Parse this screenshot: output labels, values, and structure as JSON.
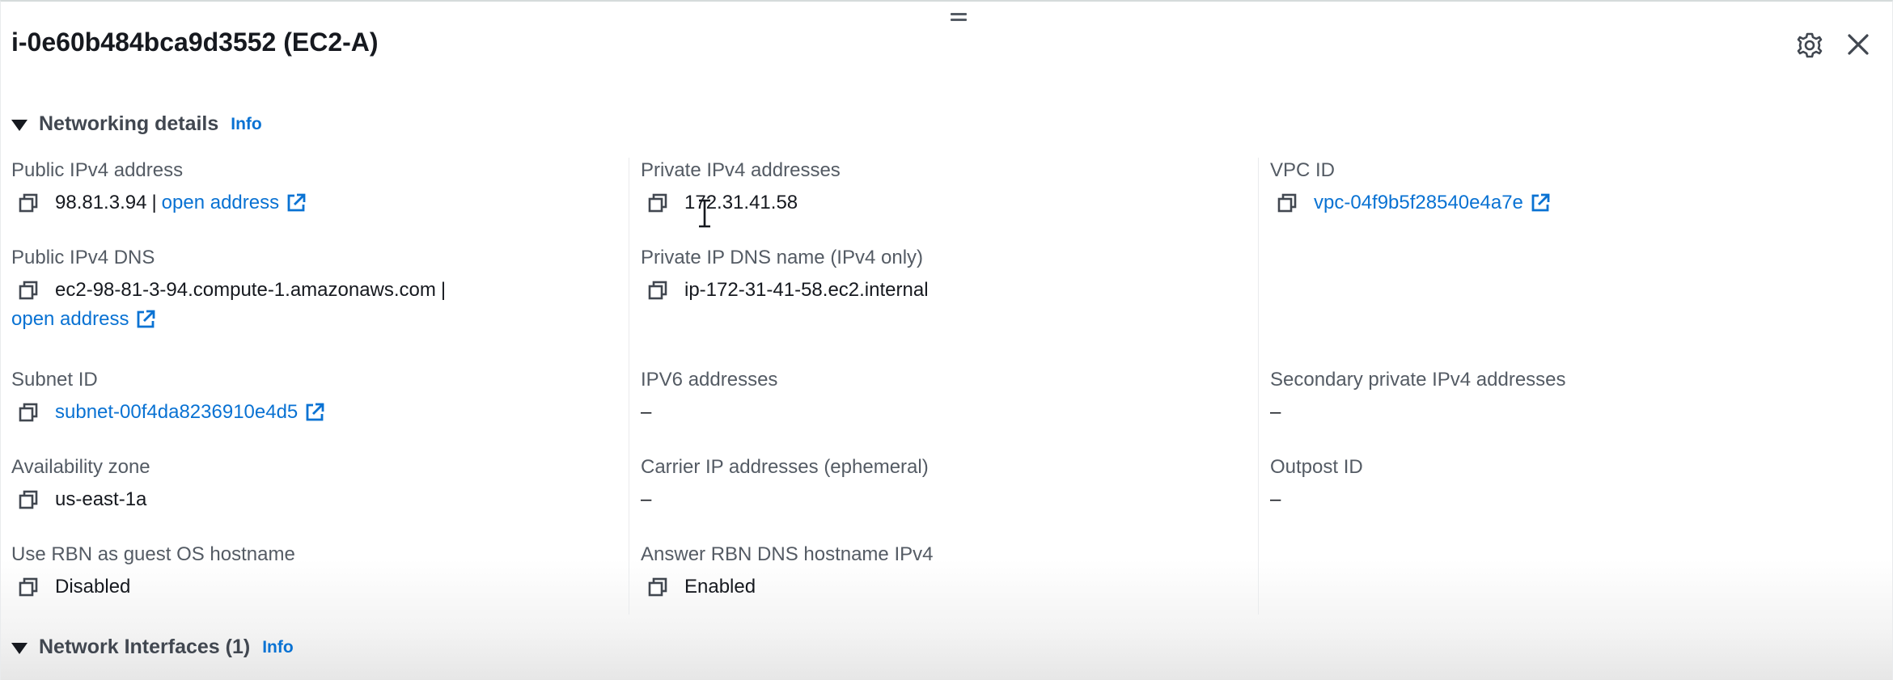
{
  "window": {
    "title": "i-0e60b484bca9d3552 (EC2-A)"
  },
  "sections": {
    "networking": {
      "label": "Networking details",
      "info": "Info"
    },
    "interfaces": {
      "label": "Network Interfaces (1)",
      "info": "Info"
    }
  },
  "fields": {
    "public_ipv4": {
      "label": "Public IPv4 address",
      "value": "98.81.3.94",
      "separator": "|",
      "link": "open address"
    },
    "private_ipv4": {
      "label": "Private IPv4 addresses",
      "value": "172.31.41.58"
    },
    "vpc_id": {
      "label": "VPC ID",
      "link": "vpc-04f9b5f28540e4a7e"
    },
    "public_dns": {
      "label": "Public IPv4 DNS",
      "value": "ec2-98-81-3-94.compute-1.amazonaws.com",
      "separator": "|",
      "link": "open address"
    },
    "private_dns": {
      "label": "Private IP DNS name (IPv4 only)",
      "value": "ip-172-31-41-58.ec2.internal"
    },
    "subnet_id": {
      "label": "Subnet ID",
      "link": "subnet-00f4da8236910e4d5"
    },
    "ipv6": {
      "label": "IPV6 addresses",
      "value": "–"
    },
    "secondary_private": {
      "label": "Secondary private IPv4 addresses",
      "value": "–"
    },
    "availability_zone": {
      "label": "Availability zone",
      "value": "us-east-1a"
    },
    "carrier_ip": {
      "label": "Carrier IP addresses (ephemeral)",
      "value": "–"
    },
    "outpost_id": {
      "label": "Outpost ID",
      "value": "–"
    },
    "rbn_hostname": {
      "label": "Use RBN as guest OS hostname",
      "value": "Disabled"
    },
    "answer_rbn": {
      "label": "Answer RBN DNS hostname IPv4",
      "value": "Enabled"
    }
  },
  "icons": {
    "copy": "copy-icon",
    "external": "external-link-icon",
    "settings": "gear-icon",
    "close": "close-icon",
    "expand": "caret-down-icon",
    "resize": "drag-handle-icon"
  },
  "colors": {
    "link": "#0972d3",
    "text": "#16191f",
    "label": "#545b64"
  }
}
